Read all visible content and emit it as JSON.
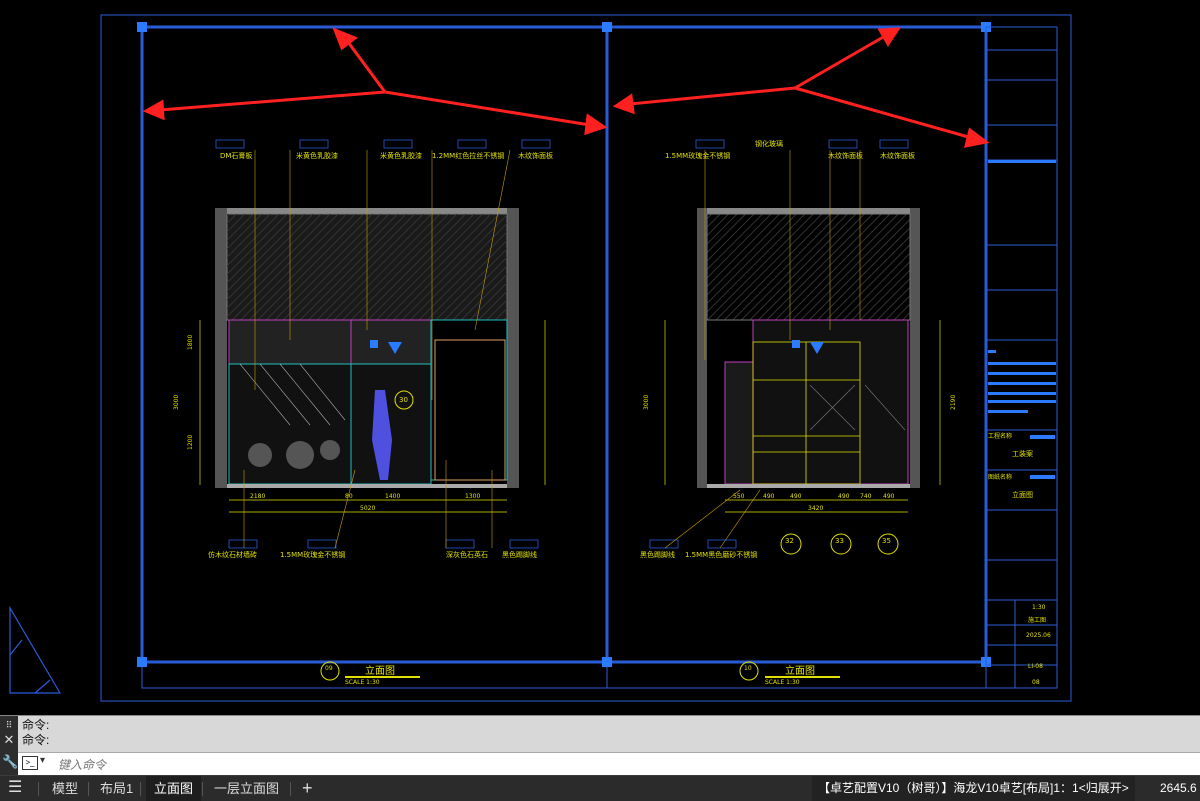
{
  "drawing": {
    "view_left_title": "立面图",
    "view_left_scale": "SCALE 1:30",
    "view_left_num": "09",
    "view_right_title": "立面图",
    "view_right_scale": "SCALE 1:30",
    "view_right_num": "10",
    "left_labels_top": [
      "DM石膏板",
      "米黄色乳胶漆",
      "米黄色乳胶漆",
      "1.2MM红色拉丝不锈钢",
      "木纹饰面板"
    ],
    "left_labels_bottom": [
      "仿木纹石材墙砖",
      "1.5MM玫瑰金不锈钢",
      "深灰色石英石",
      "黑色踢脚线"
    ],
    "right_labels_top": [
      "1.5MM玫瑰金不锈钢",
      "钢化玻璃",
      "木纹饰面板",
      "木纹饰面板"
    ],
    "right_labels_bottom": [
      "黑色踢脚线",
      "1.5MM黑色磨砂不锈钢"
    ],
    "left_dims_bottom": [
      "2180",
      "80",
      "1400",
      "1300"
    ],
    "left_total": "5020",
    "right_dims_bottom": [
      "550",
      "490",
      "490",
      "490",
      "740",
      "490"
    ],
    "right_total": "3420",
    "left_heights": [
      "3000",
      "1800",
      "1200"
    ],
    "right_heights": [
      "3000",
      "2190"
    ],
    "callouts": [
      "30",
      "32",
      "33",
      "35"
    ],
    "title_block": {
      "project_label": "工程名称",
      "project_value": "工装案",
      "drawing_label": "图纸名称",
      "drawing_value": "立面图",
      "scale": "1:30",
      "stage": "施工图",
      "date": "2025.06",
      "sheet": "LI-08",
      "page": "08"
    }
  },
  "command": {
    "history": [
      "命令:",
      "命令:"
    ],
    "placeholder": "键入命令"
  },
  "tabs": {
    "items": [
      "模型",
      "布局1",
      "立面图",
      "一层立面图"
    ],
    "active": "立面图",
    "add": "+",
    "status": "【卓艺配置V10（树哥）】海龙V10卓艺[布局]1：1<归展开>",
    "coord": "2645.6"
  },
  "colors": {
    "frame": "#2a5bd7",
    "annotation": "#e0e000",
    "arrow": "#ff2020",
    "leader": "#c8a000"
  }
}
